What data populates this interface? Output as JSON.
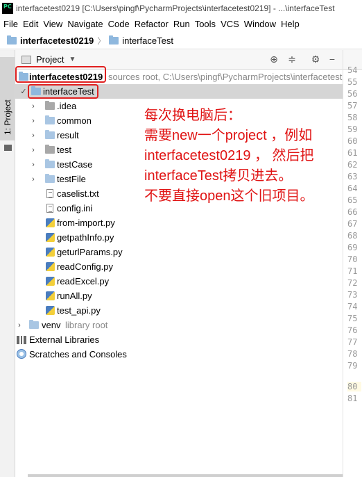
{
  "window": {
    "title": "interfacetest0219 [C:\\Users\\pingf\\PycharmProjects\\interfacetest0219] - ...\\interfaceTest"
  },
  "menu": [
    "File",
    "Edit",
    "View",
    "Navigate",
    "Code",
    "Refactor",
    "Run",
    "Tools",
    "VCS",
    "Window",
    "Help"
  ],
  "breadcrumb": {
    "root": "interfacetest0219",
    "child": "interfaceTest"
  },
  "sidebar": {
    "tab_label": "1: Project"
  },
  "project_panel": {
    "view_label": "Project",
    "root": {
      "name": "interfacetest0219",
      "hint": "sources root,  C:\\Users\\pingf\\PycharmProjects\\interfacetest"
    },
    "package": "interfaceTest",
    "folders": [
      ".idea",
      "common",
      "result",
      "test",
      "testCase",
      "testFile"
    ],
    "files": [
      {
        "name": "caselist.txt",
        "type": "text"
      },
      {
        "name": "config.ini",
        "type": "text"
      },
      {
        "name": "from-import.py",
        "type": "python"
      },
      {
        "name": "getpathInfo.py",
        "type": "python"
      },
      {
        "name": "geturlParams.py",
        "type": "python"
      },
      {
        "name": "readConfig.py",
        "type": "python"
      },
      {
        "name": "readExcel.py",
        "type": "python"
      },
      {
        "name": "runAll.py",
        "type": "python"
      },
      {
        "name": "test_api.py",
        "type": "python"
      }
    ],
    "venv": {
      "name": "venv",
      "hint": "library root"
    },
    "external_libraries": "External Libraries",
    "scratches": "Scratches and Consoles"
  },
  "editor": {
    "line_numbers": [
      "54",
      "55",
      "56",
      "57",
      "58",
      "59",
      "60",
      "61",
      "62",
      "63",
      "64",
      "65",
      "66",
      "67",
      "68",
      "69",
      "70",
      "71",
      "72",
      "73",
      "74",
      "75",
      "76",
      "77",
      "78",
      "79",
      "80",
      "81"
    ],
    "current_line": "80"
  },
  "annotation": {
    "lines": [
      "每次换电脑后：",
      "需要new一个project ，例如",
      "interfacetest0219 ，  然后把",
      "interfaceTest拷贝进去。",
      "不要直接open这个旧项目。"
    ],
    "color": "#e01414"
  },
  "colors": {
    "highlight_box": "#e02020",
    "selection": "#d5d5d5",
    "folder": "#a9c6e3"
  }
}
